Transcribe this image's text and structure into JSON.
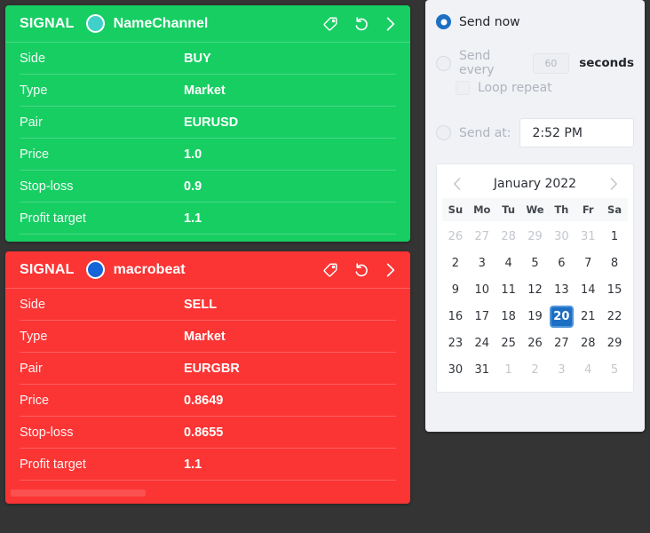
{
  "theme": {
    "background": "#343434",
    "green": "#17CE63",
    "red": "#FB3434",
    "accent_blue": "#1D6FC4",
    "panel_bg": "#F0F2F6"
  },
  "signals": [
    {
      "label": "SIGNAL",
      "channel": "NameChannel",
      "avatar_color": "#3FD0C9",
      "color": "#17CE63",
      "icons": [
        "tag-icon",
        "undo-icon",
        "chevron-right-icon"
      ],
      "rows": [
        {
          "key": "Side",
          "value": "BUY"
        },
        {
          "key": "Type",
          "value": "Market"
        },
        {
          "key": "Pair",
          "value": "EURUSD"
        },
        {
          "key": "Price",
          "value": "1.0"
        },
        {
          "key": "Stop-loss",
          "value": "0.9"
        },
        {
          "key": "Profit target",
          "value": "1.1"
        }
      ]
    },
    {
      "label": "SIGNAL",
      "channel": "macrobeat",
      "avatar_color": "#1565D8",
      "color": "#FB3434",
      "icons": [
        "tag-icon",
        "undo-icon",
        "chevron-right-icon"
      ],
      "rows": [
        {
          "key": "Side",
          "value": "SELL"
        },
        {
          "key": "Type",
          "value": "Market"
        },
        {
          "key": "Pair",
          "value": "EURGBR"
        },
        {
          "key": "Price",
          "value": "0.8649"
        },
        {
          "key": "Stop-loss",
          "value": "0.8655"
        },
        {
          "key": "Profit target",
          "value": "1.1"
        }
      ]
    }
  ],
  "schedule": {
    "send_now": {
      "label": "Send now",
      "selected": true
    },
    "send_every": {
      "label": "Send every",
      "value": "60",
      "unit": "seconds",
      "selected": false,
      "disabled": true
    },
    "loop_repeat": {
      "label": "Loop repeat",
      "checked": false,
      "disabled": true
    },
    "send_at": {
      "label": "Send at:",
      "time_value": "2:52 PM",
      "selected": false
    },
    "calendar": {
      "title": "January 2022",
      "prev_icon": "chevron-left-icon",
      "next_icon": "chevron-right-icon",
      "weekdays": [
        "Su",
        "Mo",
        "Tu",
        "We",
        "Th",
        "Fr",
        "Sa"
      ],
      "selected_day": 20,
      "weeks": [
        [
          {
            "d": "26",
            "muted": true
          },
          {
            "d": "27",
            "muted": true
          },
          {
            "d": "28",
            "muted": true
          },
          {
            "d": "29",
            "muted": true
          },
          {
            "d": "30",
            "muted": true
          },
          {
            "d": "31",
            "muted": true
          },
          {
            "d": "1",
            "muted": false
          }
        ],
        [
          {
            "d": "2",
            "muted": false
          },
          {
            "d": "3",
            "muted": false
          },
          {
            "d": "4",
            "muted": false
          },
          {
            "d": "5",
            "muted": false
          },
          {
            "d": "6",
            "muted": false
          },
          {
            "d": "7",
            "muted": false
          },
          {
            "d": "8",
            "muted": false
          }
        ],
        [
          {
            "d": "9",
            "muted": false
          },
          {
            "d": "10",
            "muted": false
          },
          {
            "d": "11",
            "muted": false
          },
          {
            "d": "12",
            "muted": false
          },
          {
            "d": "13",
            "muted": false
          },
          {
            "d": "14",
            "muted": false
          },
          {
            "d": "15",
            "muted": false
          }
        ],
        [
          {
            "d": "16",
            "muted": false
          },
          {
            "d": "17",
            "muted": false
          },
          {
            "d": "18",
            "muted": false
          },
          {
            "d": "19",
            "muted": false
          },
          {
            "d": "20",
            "muted": false,
            "selected": true
          },
          {
            "d": "21",
            "muted": false
          },
          {
            "d": "22",
            "muted": false
          }
        ],
        [
          {
            "d": "23",
            "muted": false
          },
          {
            "d": "24",
            "muted": false
          },
          {
            "d": "25",
            "muted": false
          },
          {
            "d": "26",
            "muted": false
          },
          {
            "d": "27",
            "muted": false
          },
          {
            "d": "28",
            "muted": false
          },
          {
            "d": "29",
            "muted": false
          }
        ],
        [
          {
            "d": "30",
            "muted": false
          },
          {
            "d": "31",
            "muted": false
          },
          {
            "d": "1",
            "muted": true
          },
          {
            "d": "2",
            "muted": true
          },
          {
            "d": "3",
            "muted": true
          },
          {
            "d": "4",
            "muted": true
          },
          {
            "d": "5",
            "muted": true
          }
        ]
      ]
    }
  }
}
